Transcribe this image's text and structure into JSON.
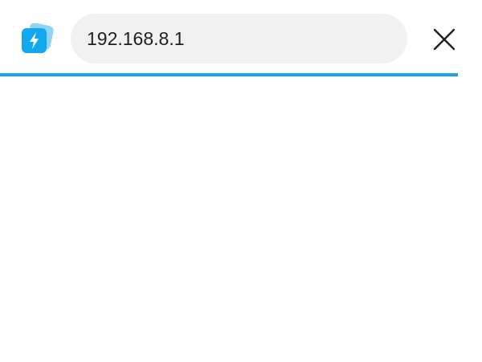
{
  "address_bar": {
    "value": "192.168.8.1",
    "icon": "bolt-app-icon",
    "close_icon": "close-icon"
  },
  "progress": {
    "fraction": 1.0
  },
  "colors": {
    "accent": "#1aa3e6",
    "icon_front": "#12a8ef",
    "icon_back": "#8fd3f7",
    "field_bg": "#f1f1f1"
  }
}
